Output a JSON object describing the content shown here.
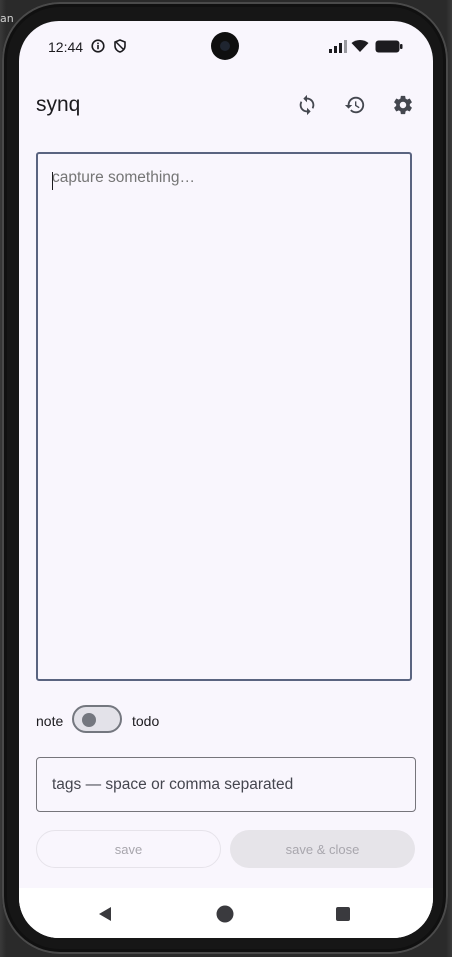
{
  "background": {
    "label": "an"
  },
  "status_bar": {
    "time": "12:44",
    "left_icons": [
      "info-icon",
      "shield-icon"
    ],
    "right_icons": [
      "signal-icon",
      "wifi-icon",
      "battery-icon"
    ]
  },
  "app_bar": {
    "title": "synq",
    "actions": [
      "sync-icon",
      "history-icon",
      "settings-icon"
    ]
  },
  "editor": {
    "placeholder": "capture something…",
    "value": ""
  },
  "mode_toggle": {
    "left_label": "note",
    "right_label": "todo",
    "state": "note"
  },
  "tags": {
    "placeholder": "tags — space or comma separated"
  },
  "buttons": {
    "save": "save",
    "save_close": "save & close"
  },
  "nav_bar": {
    "buttons": [
      "back-icon",
      "home-icon",
      "recents-icon"
    ]
  },
  "colors": {
    "background": "#f9f6fd",
    "outline": "#5a6480",
    "text": "#1c1b1f"
  }
}
